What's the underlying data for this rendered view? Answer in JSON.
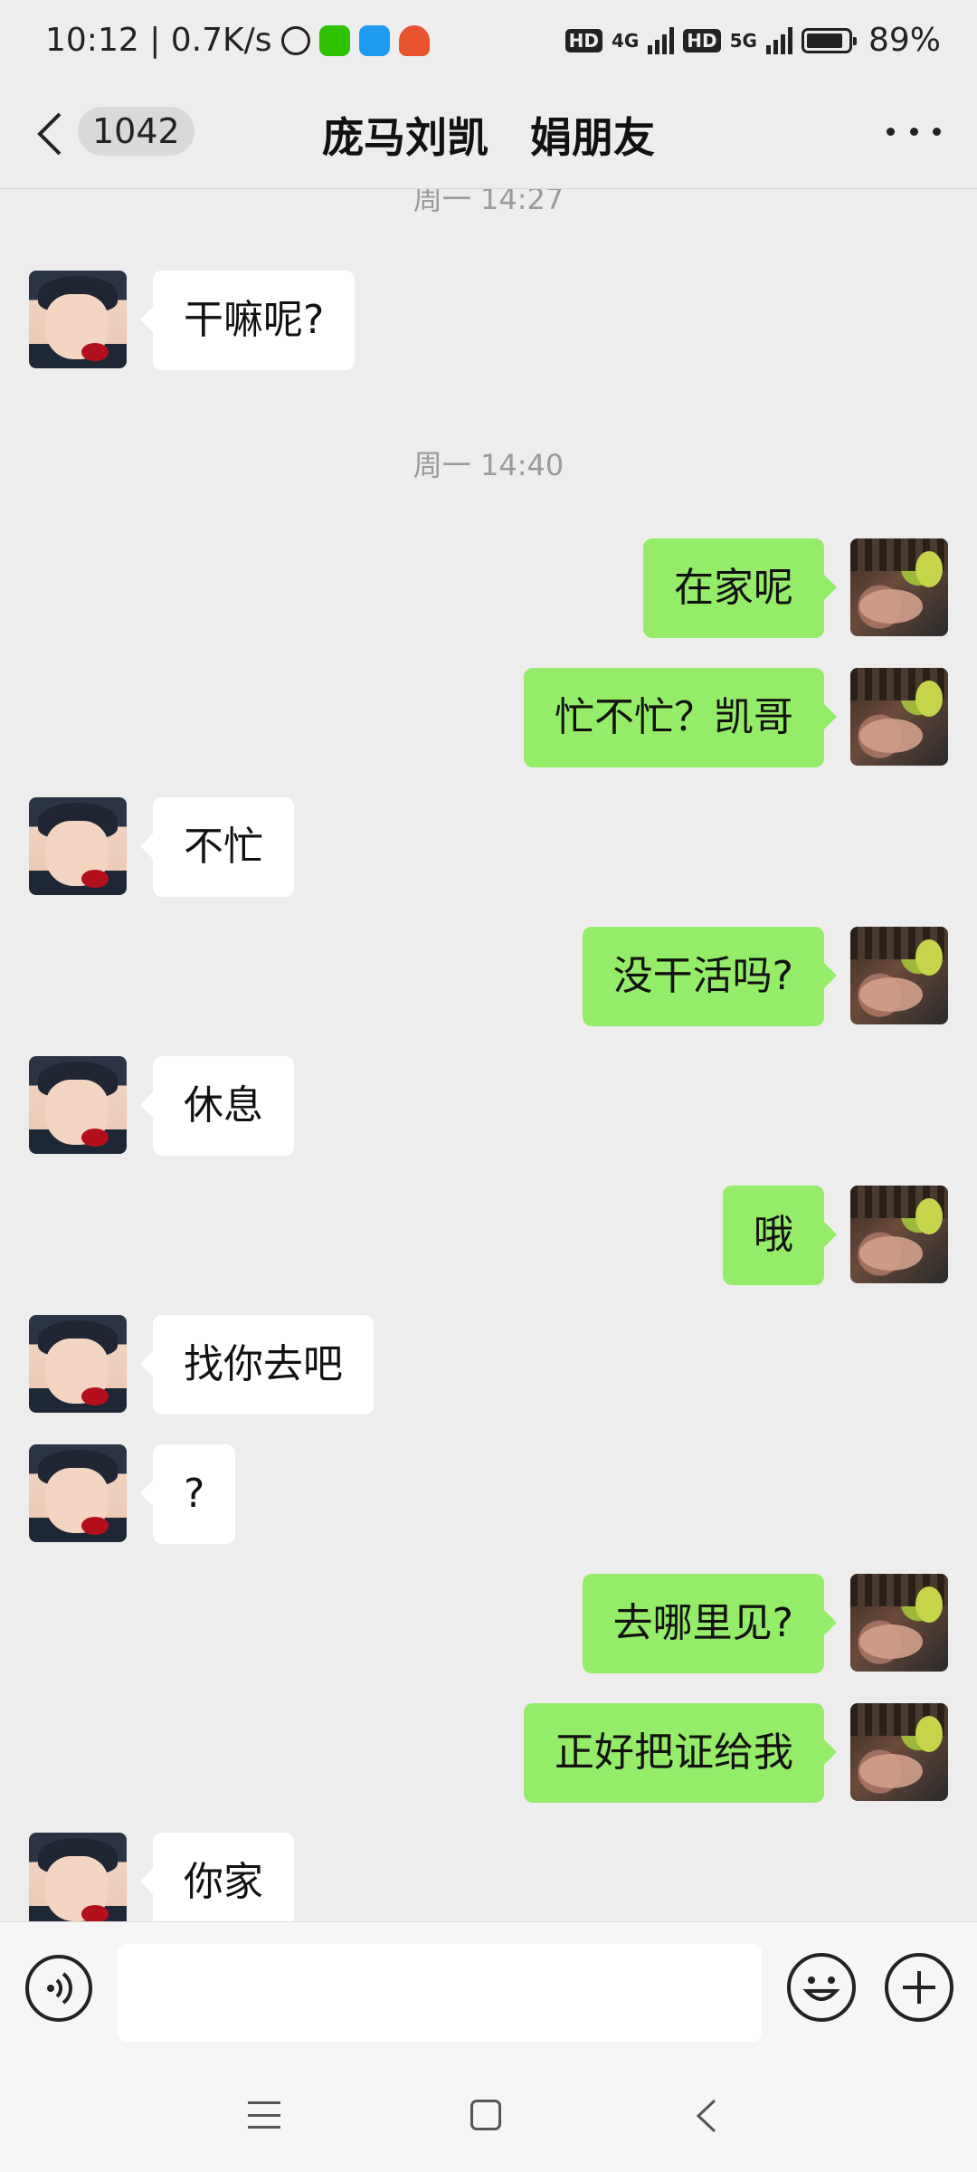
{
  "status_bar": {
    "time_speed": "10:12 | 0.7K/s",
    "hd1": "HD",
    "net1": "4G",
    "hd2": "HD",
    "net2": "5G",
    "battery": "89%",
    "icons": [
      "alarm-icon",
      "wechat-icon",
      "app-icon",
      "app-icon"
    ],
    "battery_level": 0.89
  },
  "nav": {
    "unread_count": "1042",
    "title": "庞马刘凯　娟朋友"
  },
  "timestamps": {
    "t1": "周一 14:27",
    "t2": "周一 14:40"
  },
  "messages": [
    {
      "side": "left",
      "text": "干嘛呢?"
    },
    {
      "side": "right",
      "text": "在家呢"
    },
    {
      "side": "right",
      "text": "忙不忙？凯哥"
    },
    {
      "side": "left",
      "text": "不忙"
    },
    {
      "side": "right",
      "text": "没干活吗?"
    },
    {
      "side": "left",
      "text": "休息"
    },
    {
      "side": "right",
      "text": "哦"
    },
    {
      "side": "left",
      "text": "找你去吧"
    },
    {
      "side": "left",
      "text": "?"
    },
    {
      "side": "right",
      "text": "去哪里见?"
    },
    {
      "side": "right",
      "text": "正好把证给我"
    },
    {
      "side": "left",
      "text": "你家"
    }
  ],
  "input": {
    "value": "",
    "placeholder": ""
  },
  "colors": {
    "background": "#ededed",
    "sent_bubble": "#95ec69",
    "received_bubble": "#ffffff"
  }
}
